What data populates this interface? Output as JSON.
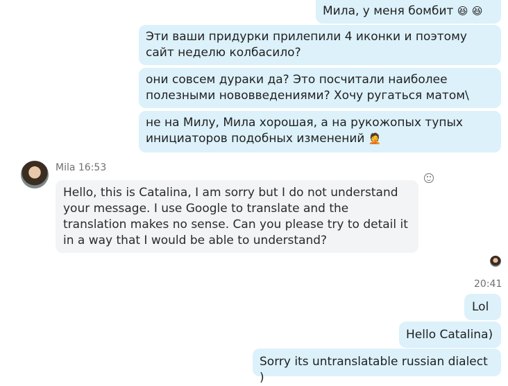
{
  "messages_out_top": [
    "Мила, у меня бомбит",
    "Эти ваши придурки прилепили 4 иконки и поэтому сайт неделю колбасило?",
    "они совсем дураки да? Это посчитали наиболее полезными нововведениями? Хочу ругаться матом\\",
    "не на Милу, Мила хорошая, а на рукожопых тупых инициаторов подобных изменений"
  ],
  "emoji": {
    "grin": "😆",
    "facepalm": "🤦"
  },
  "incoming": {
    "sender": "Mila",
    "time": "16:53",
    "text": "Hello, this is Catalina, I am sorry but I do not understand your message. I use Google to translate and the translation makes no sense. Can you please try to detail it in a way that I would be able to understand?"
  },
  "outgoing_later": {
    "time": "20:41",
    "messages": [
      "Lol",
      "Hello Catalina)",
      "Sorry its untranslatable russian dialect )"
    ]
  }
}
